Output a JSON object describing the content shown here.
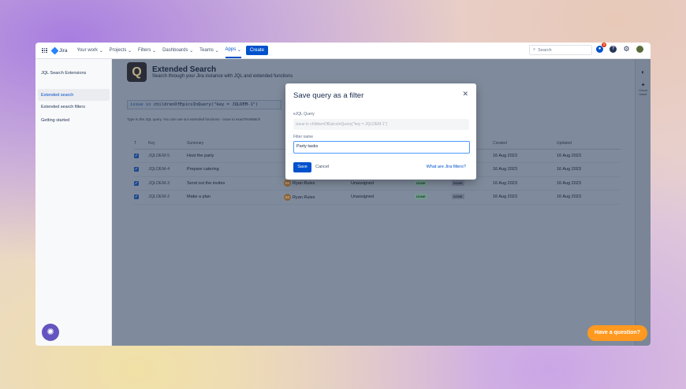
{
  "nav": {
    "product": "Jira",
    "items": [
      "Your work",
      "Projects",
      "Filters",
      "Dashboards",
      "Teams",
      "Apps"
    ],
    "active": "Apps",
    "create": "Create",
    "search_placeholder": "Search",
    "notifications": "5"
  },
  "sidebar": {
    "title": "JQL Search Extensions",
    "items": [
      "Extended search",
      "Extended search filters",
      "Getting started"
    ]
  },
  "header": {
    "title": "Extended Search",
    "subtitle": "Search through your Jira instance with JQL and extended functions"
  },
  "query": {
    "keyword": "issue",
    "op": "in",
    "rest": "childrenOfEpicsInQuery(\"key = JQLDEM-1\")",
    "hint": "Type in the JQL query. You can use our extended functions - issue in exactTextMatch"
  },
  "table": {
    "headers": [
      "T",
      "Key",
      "Summary",
      "",
      "",
      "",
      "",
      "Created",
      "Updated"
    ],
    "rows": [
      {
        "key": "JQLDEM-5",
        "summary": "Host the party",
        "assignee": "",
        "reporter": "",
        "status": "",
        "resolution": "",
        "created": "16 Aug 2023",
        "updated": "16 Aug 2023"
      },
      {
        "key": "JQLDEM-4",
        "summary": "Prepare catering",
        "assignee": "",
        "reporter": "",
        "status": "",
        "resolution": "",
        "created": "16 Aug 2023",
        "updated": "16 Aug 2023"
      },
      {
        "key": "JQLDEM-3",
        "summary": "Send out the invites",
        "initials": "RR",
        "assignee": "Ryan Rules",
        "reporter": "Unassigned",
        "status": "DONE",
        "resolution": "DONE",
        "created": "16 Aug 2023",
        "updated": "16 Aug 2023"
      },
      {
        "key": "JQLDEM-2",
        "summary": "Make a plan",
        "initials": "RR",
        "assignee": "Ryan Rules",
        "reporter": "Unassigned",
        "status": "DONE",
        "resolution": "DONE",
        "created": "16 Aug 2023",
        "updated": "16 Aug 2023"
      }
    ]
  },
  "right_panel": {
    "label": "Cheat sheet"
  },
  "modal": {
    "title": "Save query as a filter",
    "query_label": "eJQL Query",
    "query_value": "issue in childrenOfEpicsInQuery(\"key = JQLDEM-1\")",
    "name_label": "Filter name",
    "name_value": "Party tasks",
    "save": "Save",
    "cancel": "Cancel",
    "help_link": "What are Jira filters?"
  },
  "help_button": "Have a question?"
}
